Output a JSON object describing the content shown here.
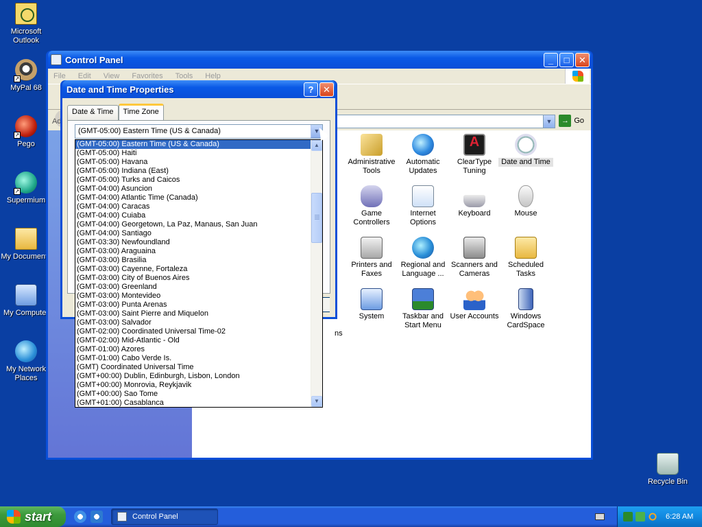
{
  "desktop": {
    "icons": [
      {
        "label": "Microsoft Outlook",
        "icon": "outlook-icon"
      },
      {
        "label": "MyPal 68",
        "icon": "mypal-icon"
      },
      {
        "label": "Pego",
        "icon": "pego-icon"
      },
      {
        "label": "Supermium",
        "icon": "supermium-icon"
      },
      {
        "label": "My Documents",
        "icon": "my-documents-icon"
      },
      {
        "label": "My Computer",
        "icon": "my-computer-icon"
      },
      {
        "label": "My Network Places",
        "icon": "network-places-icon"
      },
      {
        "label": "Recycle Bin",
        "icon": "recycle-bin-icon"
      }
    ],
    "outlook_line1": "Microsoft",
    "outlook_line2": "Outlook",
    "network_line1": "My Network",
    "network_line2": "Places"
  },
  "control_panel": {
    "title": "Control Panel",
    "menu": [
      "File",
      "Edit",
      "View",
      "Favorites",
      "Tools",
      "Help"
    ],
    "address_label": "Ad",
    "go_label": "Go",
    "partial_label": "ns",
    "items": [
      {
        "line1": "Administrative",
        "line2": "Tools",
        "icon": "administrative-tools-icon"
      },
      {
        "line1": "Automatic",
        "line2": "Updates",
        "icon": "automatic-updates-icon"
      },
      {
        "line1": "ClearType",
        "line2": "Tuning",
        "icon": "cleartype-icon"
      },
      {
        "line1": "Date and Time",
        "line2": "",
        "icon": "date-time-icon"
      },
      {
        "line1": "Game",
        "line2": "Controllers",
        "icon": "game-controllers-icon"
      },
      {
        "line1": "Internet",
        "line2": "Options",
        "icon": "internet-options-icon"
      },
      {
        "line1": "Keyboard",
        "line2": "",
        "icon": "keyboard-icon"
      },
      {
        "line1": "Mouse",
        "line2": "",
        "icon": "mouse-icon"
      },
      {
        "line1": "Printers and",
        "line2": "Faxes",
        "icon": "printers-icon"
      },
      {
        "line1": "Regional and",
        "line2": "Language ...",
        "icon": "regional-icon"
      },
      {
        "line1": "Scanners and",
        "line2": "Cameras",
        "icon": "scanners-icon"
      },
      {
        "line1": "Scheduled",
        "line2": "Tasks",
        "icon": "scheduled-tasks-icon"
      },
      {
        "line1": "System",
        "line2": "",
        "icon": "system-icon"
      },
      {
        "line1": "Taskbar and",
        "line2": "Start Menu",
        "icon": "taskbar-icon"
      },
      {
        "line1": "User Accounts",
        "line2": "",
        "icon": "user-accounts-icon"
      },
      {
        "line1": "Windows",
        "line2": "CardSpace",
        "icon": "cardspace-icon"
      }
    ]
  },
  "dialog": {
    "title": "Date and Time Properties",
    "help_label": "?",
    "close_label": "✕",
    "tabs": [
      "Date & Time",
      "Time Zone"
    ],
    "active_tab": "Time Zone",
    "selected_zone": "(GMT-05:00) Eastern Time (US & Canada)"
  },
  "timezone_list": [
    "(GMT-05:00) Eastern Time (US & Canada)",
    "(GMT-05:00) Haiti",
    "(GMT-05:00) Havana",
    "(GMT-05:00) Indiana (East)",
    "(GMT-05:00) Turks and Caicos",
    "(GMT-04:00) Asuncion",
    "(GMT-04:00) Atlantic Time (Canada)",
    "(GMT-04:00) Caracas",
    "(GMT-04:00) Cuiaba",
    "(GMT-04:00) Georgetown, La Paz, Manaus, San Juan",
    "(GMT-04:00) Santiago",
    "(GMT-03:30) Newfoundland",
    "(GMT-03:00) Araguaina",
    "(GMT-03:00) Brasilia",
    "(GMT-03:00) Cayenne, Fortaleza",
    "(GMT-03:00) City of Buenos Aires",
    "(GMT-03:00) Greenland",
    "(GMT-03:00) Montevideo",
    "(GMT-03:00) Punta Arenas",
    "(GMT-03:00) Saint Pierre and Miquelon",
    "(GMT-03:00) Salvador",
    "(GMT-02:00) Coordinated Universal Time-02",
    "(GMT-02:00) Mid-Atlantic - Old",
    "(GMT-01:00) Azores",
    "(GMT-01:00) Cabo Verde Is.",
    "(GMT) Coordinated Universal Time",
    "(GMT+00:00) Dublin, Edinburgh, Lisbon, London",
    "(GMT+00:00) Monrovia, Reykjavik",
    "(GMT+00:00) Sao Tome",
    "(GMT+01:00) Casablanca"
  ],
  "taskbar": {
    "start_label": "start",
    "task_label": "Control Panel",
    "clock": "6:28 AM"
  },
  "glyphs": {
    "minimize": "_",
    "maximize": "□",
    "close": "✕",
    "dropdown": "▼",
    "scroll_up": "▲",
    "scroll_down": "▼",
    "go": "→"
  }
}
